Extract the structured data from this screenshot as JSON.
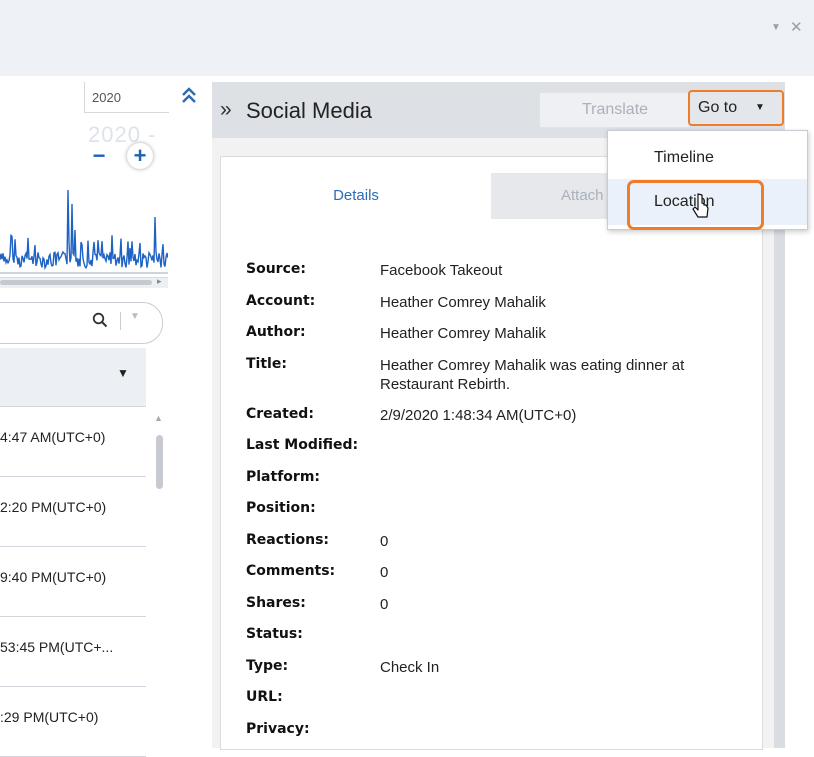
{
  "window": {
    "dropdown_glyph": "▼",
    "close_glyph": "✕"
  },
  "timeline_chart": {
    "year_label": "2020",
    "year_ghost": "2020 -",
    "zoom_out": "−",
    "zoom_in": "+"
  },
  "search": {
    "icon": "search-icon"
  },
  "list": {
    "rows": [
      "4:47 AM(UTC+0)",
      "2:20 PM(UTC+0)",
      "9:40 PM(UTC+0)",
      "53:45 PM(UTC+...",
      ":29 PM(UTC+0)"
    ]
  },
  "panel": {
    "title": "Social Media",
    "translate_label": "Translate",
    "goto_label": "Go to",
    "tabs": {
      "details": "Details",
      "attachments": "Attach"
    }
  },
  "menu": {
    "timeline": "Timeline",
    "location": "Location"
  },
  "fields": [
    {
      "label": "Source:",
      "value": "Facebook Takeout"
    },
    {
      "label": "Account:",
      "value": "Heather Comrey Mahalik"
    },
    {
      "label": "Author:",
      "value": "Heather Comrey Mahalik"
    },
    {
      "label": "Title:",
      "value": "Heather Comrey Mahalik was eating dinner at Restaurant Rebirth."
    },
    {
      "label": "Created:",
      "value": "2/9/2020 1:48:34 AM(UTC+0)"
    },
    {
      "label": "Last Modified:",
      "value": ""
    },
    {
      "label": "Platform:",
      "value": ""
    },
    {
      "label": "Position:",
      "value": ""
    },
    {
      "label": "Reactions:",
      "value": "0"
    },
    {
      "label": "Comments:",
      "value": "0"
    },
    {
      "label": "Shares:",
      "value": "0"
    },
    {
      "label": "Status:",
      "value": ""
    },
    {
      "label": "Type:",
      "value": "Check In"
    },
    {
      "label": "URL:",
      "value": ""
    },
    {
      "label": "Privacy:",
      "value": ""
    }
  ],
  "colors": {
    "accent": "#2c6cb4",
    "highlight": "#f07c2a",
    "chart": "#1d62c4"
  }
}
